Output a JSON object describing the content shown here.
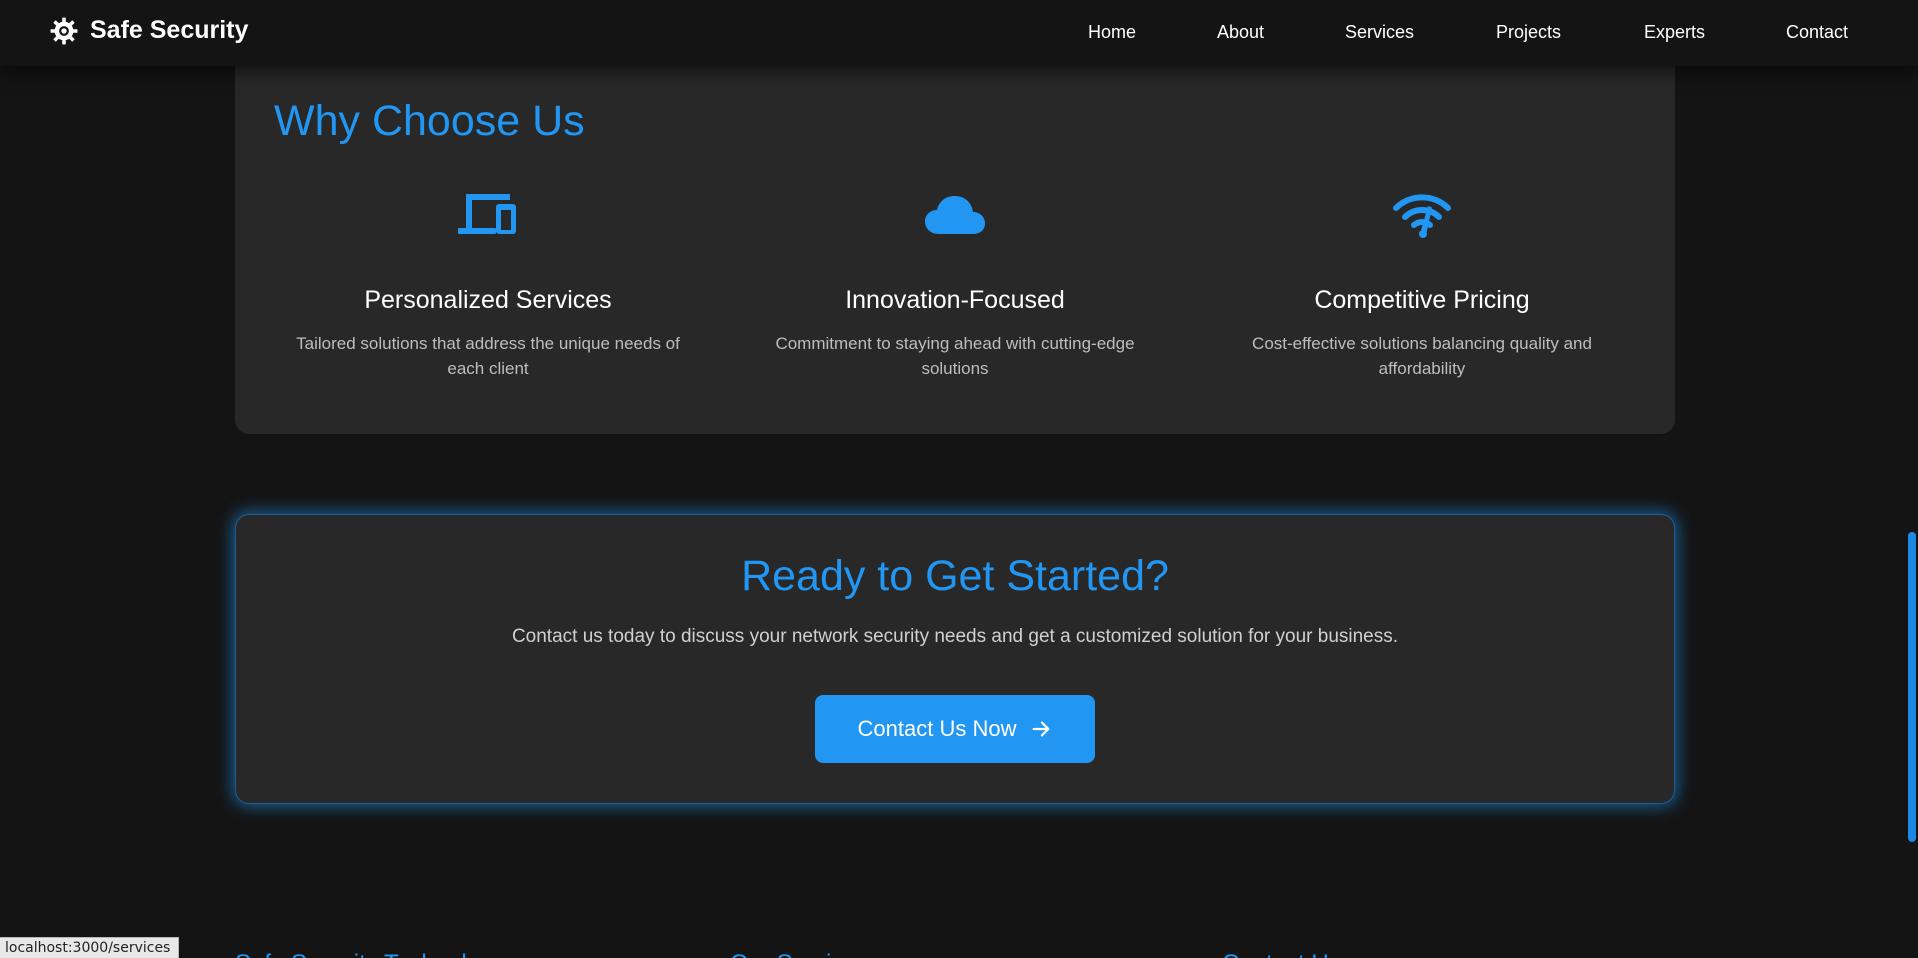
{
  "brand": {
    "name": "Safe Security",
    "icon": "gear-icon"
  },
  "nav": {
    "items": [
      {
        "label": "Home"
      },
      {
        "label": "About"
      },
      {
        "label": "Services"
      },
      {
        "label": "Projects"
      },
      {
        "label": "Experts"
      },
      {
        "label": "Contact"
      }
    ]
  },
  "why": {
    "title": "Why Choose Us",
    "features": [
      {
        "icon": "devices-icon",
        "title": "Personalized Services",
        "description": "Tailored solutions that address the unique needs of each client"
      },
      {
        "icon": "cloud-icon",
        "title": "Innovation-Focused",
        "description": "Commitment to staying ahead with cutting-edge solutions"
      },
      {
        "icon": "wifi-speed-icon",
        "title": "Competitive Pricing",
        "description": "Cost-effective solutions balancing quality and affordability"
      }
    ]
  },
  "cta": {
    "title": "Ready to Get Started?",
    "description": "Contact us today to discuss your network security needs and get a customized solution for your business.",
    "button_label": "Contact Us Now",
    "button_icon": "arrow-right-icon"
  },
  "footer": {
    "headings": [
      "Safe Security Technology",
      "Our Services",
      "Contact Us"
    ]
  },
  "status_url": "localhost:3000/services",
  "colors": {
    "accent": "#2196f3",
    "background": "#141414",
    "card": "#282828"
  }
}
